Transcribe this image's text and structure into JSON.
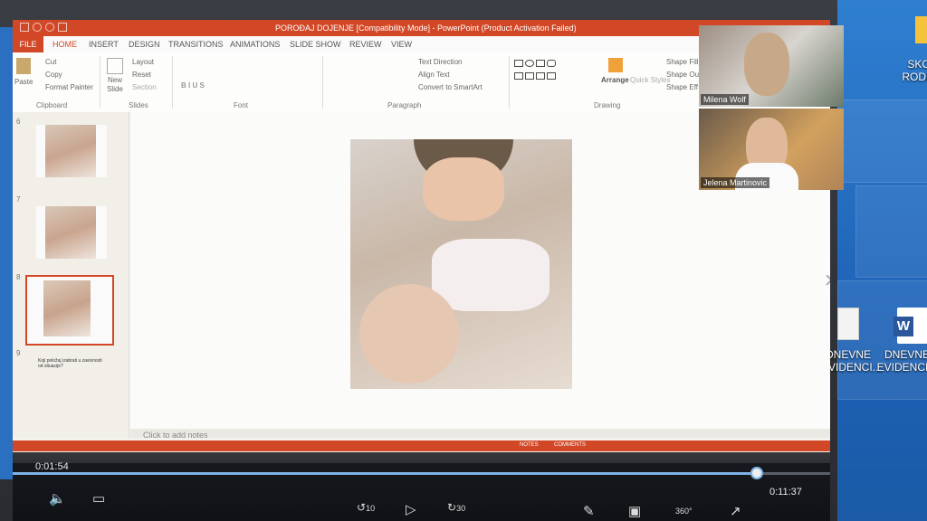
{
  "window": {
    "title": "POROĐAJ DOJENJE [Compatibility Mode] - PowerPoint (Product Activation Failed)"
  },
  "ribbon_tabs": [
    {
      "label": "FILE"
    },
    {
      "label": "HOME"
    },
    {
      "label": "INSERT"
    },
    {
      "label": "DESIGN"
    },
    {
      "label": "TRANSITIONS"
    },
    {
      "label": "ANIMATIONS"
    },
    {
      "label": "SLIDE SHOW"
    },
    {
      "label": "REVIEW"
    },
    {
      "label": "VIEW"
    }
  ],
  "ribbon": {
    "paste": "Paste",
    "cut": "Cut",
    "copy": "Copy",
    "format_painter": "Format Painter",
    "clipboard": "Clipboard",
    "new_slide": "New Slide",
    "layout": "Layout",
    "reset": "Reset",
    "section": "Section",
    "slides": "Slides",
    "font": "Font",
    "text_direction": "Text Direction",
    "align_text": "Align Text",
    "convert_smartart": "Convert to SmartArt",
    "paragraph": "Paragraph",
    "arrange": "Arrange",
    "quick_styles": "Quick Styles",
    "shape_fill": "Shape Fill",
    "shape_outline": "Shape Ou",
    "shape_effects": "Shape Eff",
    "drawing": "Drawing"
  },
  "thumbnails": [
    {
      "number": "6"
    },
    {
      "number": "7"
    },
    {
      "number": "8"
    },
    {
      "number": "9",
      "text": "Koji položaj izabrati u zavisnosti od situacije?"
    }
  ],
  "notes_placeholder": "Click to add notes",
  "video_participants": [
    {
      "name": "Milena Wolf"
    },
    {
      "name": "Jelena Martinovic"
    }
  ],
  "desktop_icons": [
    {
      "label": "SKO\nRODIT"
    },
    {
      "label": "DNEVNE\nEVIDENCI..."
    },
    {
      "label": "DNEVNE\nEVIDENCI..."
    }
  ],
  "player": {
    "elapsed": "0:01:54",
    "remaining": "0:11:37",
    "progress": 0.91,
    "rewind_seconds": "10",
    "forward_seconds": "30",
    "view_360": "360°"
  }
}
